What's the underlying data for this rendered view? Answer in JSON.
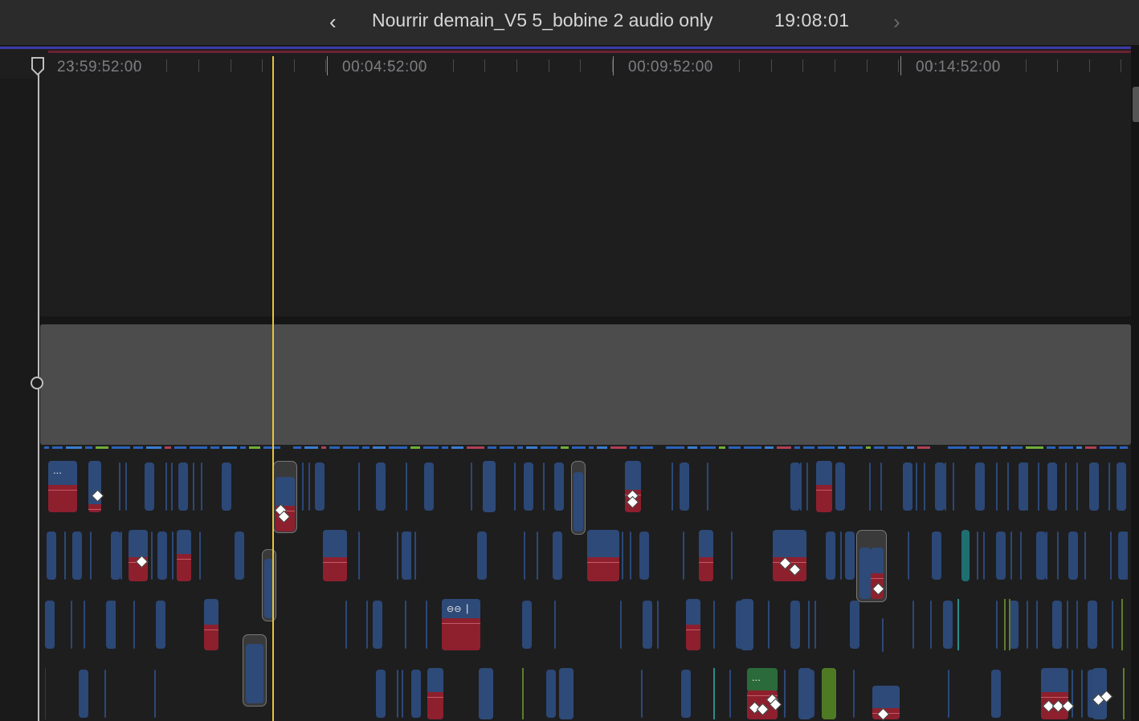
{
  "header": {
    "back_icon": "chevron-left-icon",
    "title": "Nourrir demain_V5 5_bobine 2 audio only",
    "timecode": "19:08:01",
    "forward_icon": "chevron-right-icon"
  },
  "ruler": {
    "labels": [
      "23:59:52:00",
      "00:04:52:00",
      "00:09:52:00",
      "00:14:52:00"
    ]
  },
  "clips": {
    "badge_more": "...",
    "badge_more_green": "...",
    "badge_link_icon": "link-icon",
    "badge_link_text": "|"
  },
  "colors": {
    "playhead": "#e7c33d",
    "clip_blue": "#2e4a78",
    "clip_red": "#8e1f2d",
    "storyline": "#4c4c4d"
  }
}
